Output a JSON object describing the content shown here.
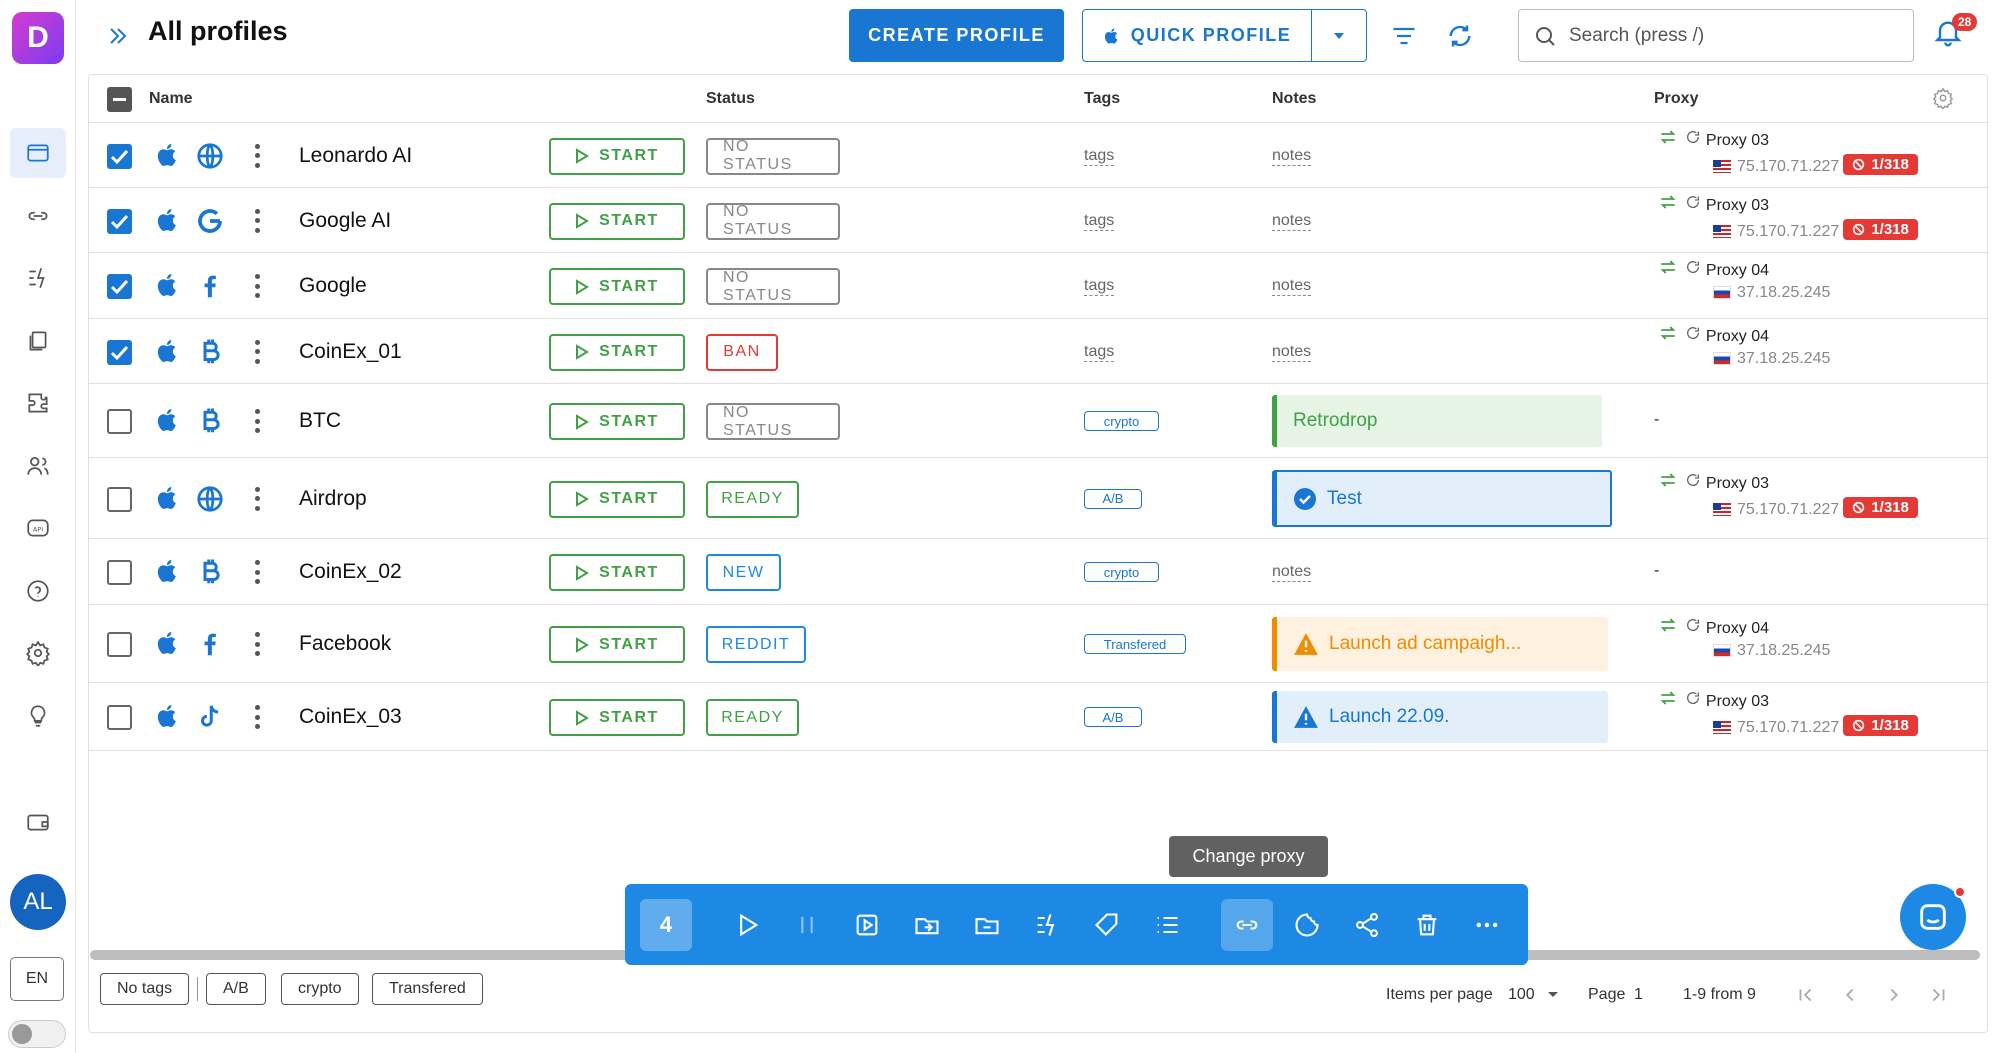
{
  "app": {
    "logo_letter": "D",
    "title": "All profiles"
  },
  "header": {
    "create_label": "CREATE PROFILE",
    "quick_label": "QUICK PROFILE",
    "search_placeholder": "Search (press /)",
    "notifications_count": "28"
  },
  "sidebar": {
    "avatar": "AL",
    "lang": "EN"
  },
  "table": {
    "columns": {
      "name": "Name",
      "status": "Status",
      "tags": "Tags",
      "notes": "Notes",
      "proxy": "Proxy"
    },
    "start_label": "START",
    "rows": [
      {
        "checked": true,
        "name": "Leonardo AI",
        "icon": "globe-icon",
        "status": "NO STATUS",
        "status_color": "gray",
        "tags": "tags",
        "tag_style": "text",
        "notes": "notes",
        "note_style": "text",
        "proxy_name": "Proxy 03",
        "proxy_ip": "75.170.71.227",
        "flag": "us",
        "ban": "1/318"
      },
      {
        "checked": true,
        "name": "Google AI",
        "icon": "google-icon",
        "status": "NO STATUS",
        "status_color": "gray",
        "tags": "tags",
        "tag_style": "text",
        "notes": "notes",
        "note_style": "text",
        "proxy_name": "Proxy 03",
        "proxy_ip": "75.170.71.227",
        "flag": "us",
        "ban": "1/318"
      },
      {
        "checked": true,
        "name": "Google",
        "icon": "facebook-icon",
        "status": "NO STATUS",
        "status_color": "gray",
        "tags": "tags",
        "tag_style": "text",
        "notes": "notes",
        "note_style": "text",
        "proxy_name": "Proxy 04",
        "proxy_ip": "37.18.25.245",
        "flag": "ru",
        "ban": ""
      },
      {
        "checked": true,
        "name": "CoinEx_01",
        "icon": "bitcoin-icon",
        "status": "BAN",
        "status_color": "red",
        "tags": "tags",
        "tag_style": "text",
        "notes": "notes",
        "note_style": "text",
        "proxy_name": "Proxy 04",
        "proxy_ip": "37.18.25.245",
        "flag": "ru",
        "ban": ""
      },
      {
        "checked": false,
        "name": "BTC",
        "icon": "bitcoin-icon",
        "status": "NO STATUS",
        "status_color": "gray",
        "tags": "crypto",
        "tag_style": "chip",
        "notes": "Retrodrop",
        "note_style": "green",
        "proxy_name": "-",
        "proxy_ip": "",
        "flag": "",
        "ban": ""
      },
      {
        "checked": false,
        "name": "Airdrop",
        "icon": "globe-icon",
        "status": "READY",
        "status_color": "green",
        "tags": "A/B",
        "tag_style": "chip",
        "notes": "Test",
        "note_style": "blue",
        "proxy_name": "Proxy 03",
        "proxy_ip": "75.170.71.227",
        "flag": "us",
        "ban": "1/318"
      },
      {
        "checked": false,
        "name": "CoinEx_02",
        "icon": "bitcoin-icon",
        "status": "NEW",
        "status_color": "blue",
        "tags": "crypto",
        "tag_style": "chip",
        "notes": "notes",
        "note_style": "text",
        "proxy_name": "-",
        "proxy_ip": "",
        "flag": "",
        "ban": ""
      },
      {
        "checked": false,
        "name": "Facebook",
        "icon": "facebook-icon",
        "status": "REDDIT",
        "status_color": "blue",
        "tags": "Transfered",
        "tag_style": "chip",
        "notes": "Launch ad campaigh...",
        "note_style": "orange",
        "proxy_name": "Proxy 04",
        "proxy_ip": "37.18.25.245",
        "flag": "ru",
        "ban": ""
      },
      {
        "checked": false,
        "name": "CoinEx_03",
        "icon": "tiktok-icon",
        "status": "READY",
        "status_color": "green",
        "tags": "A/B",
        "tag_style": "chip",
        "notes": "Launch 22.09.",
        "note_style": "lblue",
        "proxy_name": "Proxy 03",
        "proxy_ip": "75.170.71.227",
        "flag": "us",
        "ban": "1/318"
      }
    ]
  },
  "action_bar": {
    "selected_count": "4",
    "tooltip": "Change proxy"
  },
  "footer": {
    "tag_filters": [
      "No tags",
      "A/B",
      "crypto",
      "Transfered"
    ],
    "items_per_page_label": "Items per page",
    "items_per_page": "100",
    "page_label": "Page",
    "page": "1",
    "range": "1-9 from 9"
  },
  "colors": {
    "primary": "#1976d2",
    "success": "#43a047",
    "danger": "#e53935",
    "warning": "#f08c00"
  }
}
